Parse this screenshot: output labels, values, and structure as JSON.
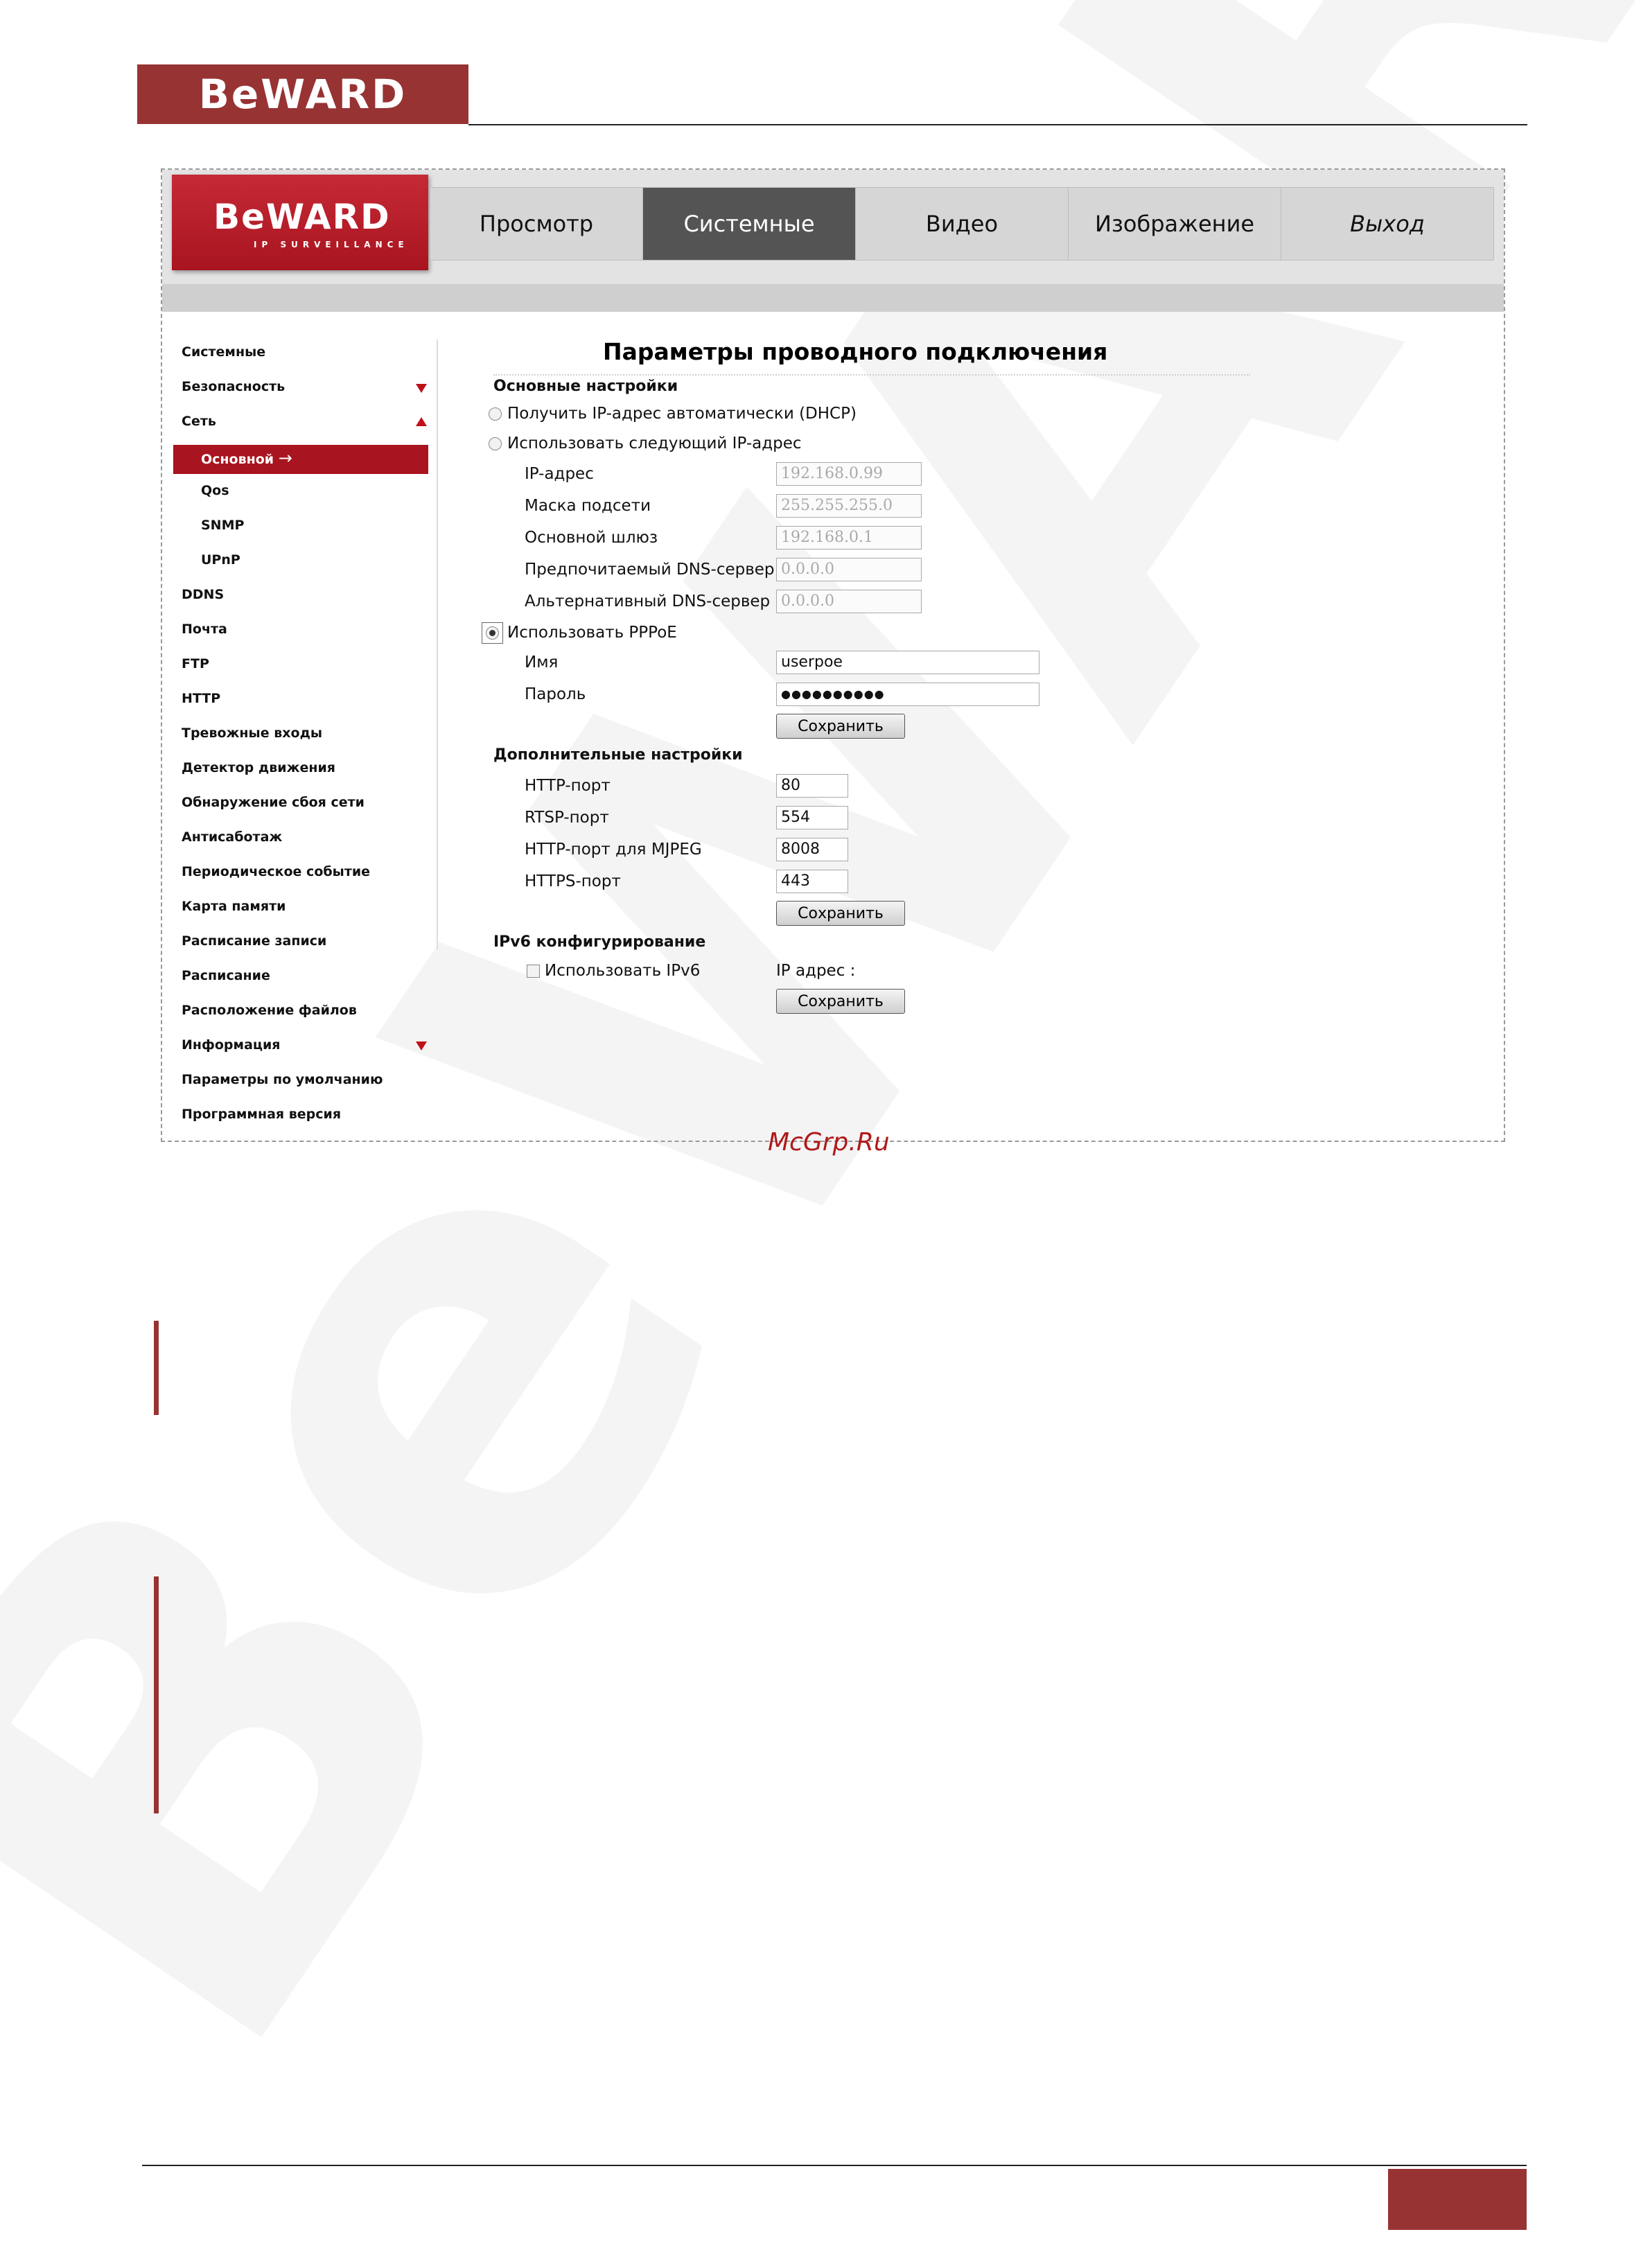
{
  "document": {
    "logo_text": "BeWARD",
    "watermark_text": "BeWARD",
    "footer_page_number": ""
  },
  "app": {
    "logo": {
      "name": "BeWARD",
      "tagline": "IP SURVEILLANCE"
    },
    "nav_tabs": [
      {
        "label": "Просмотр"
      },
      {
        "label": "Системные"
      },
      {
        "label": "Видео"
      },
      {
        "label": "Изображение"
      },
      {
        "label": "Выход"
      }
    ],
    "active_tab": "Системные",
    "sidebar": {
      "items": [
        {
          "label": "Системные"
        },
        {
          "label": "Безопасность"
        },
        {
          "label": "Сеть"
        },
        {
          "label": "Основной"
        },
        {
          "label": "Qos"
        },
        {
          "label": "SNMP"
        },
        {
          "label": "UPnP"
        },
        {
          "label": "DDNS"
        },
        {
          "label": "Почта"
        },
        {
          "label": "FTP"
        },
        {
          "label": "HTTP"
        },
        {
          "label": "Тревожные входы"
        },
        {
          "label": "Детектор движения"
        },
        {
          "label": "Обнаружение сбоя сети"
        },
        {
          "label": "Антисаботаж"
        },
        {
          "label": "Периодическое событие"
        },
        {
          "label": "Карта памяти"
        },
        {
          "label": "Расписание записи"
        },
        {
          "label": "Расписание"
        },
        {
          "label": "Расположение файлов"
        },
        {
          "label": "Информация"
        },
        {
          "label": "Параметры по умолчанию"
        },
        {
          "label": "Программная версия"
        }
      ],
      "active_arrow": "→"
    },
    "form": {
      "title": "Параметры проводного подключения",
      "basic_section": "Основные настройки",
      "dhcp_label": "Получить IP-адрес автоматически (DHCP)",
      "static_label": "Использовать следующий IP-адрес",
      "ip_label": "IP-адрес",
      "ip_value": "192.168.0.99",
      "mask_label": "Маска подсети",
      "mask_value": "255.255.255.0",
      "gateway_label": "Основной шлюз",
      "gateway_value": "192.168.0.1",
      "dns1_label": "Предпочитаемый DNS-сервер",
      "dns1_value": "0.0.0.0",
      "dns2_label": "Альтернативный DNS-сервер",
      "dns2_value": "0.0.0.0",
      "pppoe_label": "Использовать PPPoE",
      "name_label": "Имя",
      "name_value": "userpoe",
      "password_label": "Пароль",
      "password_value": "●●●●●●●●●●",
      "save_label": "Сохранить",
      "advanced_section": "Дополнительные настройки",
      "http_port_label": "HTTP-порт",
      "http_port_value": "80",
      "rtsp_port_label": "RTSP-порт",
      "rtsp_port_value": "554",
      "mjpeg_port_label": "HTTP-порт для MJPEG",
      "mjpeg_port_value": "8008",
      "https_port_label": "HTTPS-порт",
      "https_port_value": "443",
      "ipv6_section": "IPv6 конфигурирование",
      "ipv6_checkbox_label": "Использовать IPv6",
      "ipv6_address_label": "IP адрес :",
      "selected_mode": "pppoe"
    }
  },
  "source_watermark": "McGrp.Ru",
  "colors": {
    "brand_red": "#983333",
    "logo_red": "#b31a24",
    "active_tab": "#545454",
    "accent_arrow": "#c0101a"
  }
}
